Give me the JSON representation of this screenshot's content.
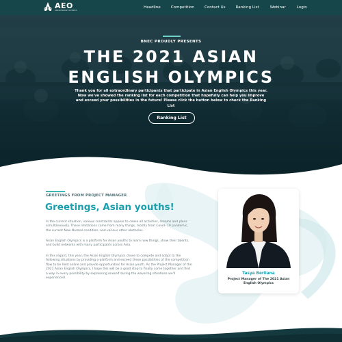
{
  "logo": {
    "text": "AEO",
    "subtitle": "ASIAN ENGLISH OLYMPICS"
  },
  "nav": {
    "items": [
      "Headline",
      "Competition",
      "Contact Us",
      "Ranking List",
      "Webinar",
      "Login"
    ]
  },
  "hero": {
    "presents": "BNEC PROUDLY PRESENTS",
    "title_line1": "The 2021 Asian",
    "title_line2": "English Olympics",
    "description": "Thank you for all extraordinary participants that participate in Asian English Olympics this year. Now we've showed the ranking list for each competition that hopefully can help you improve and exceed your possibilities in the future! Please click the button below to check the Ranking List",
    "button_label": "Ranking List"
  },
  "greeting": {
    "label": "GREETINGS FROM PROJECT MANAGER",
    "title": "Greetings, Asian youths!",
    "paragraphs": [
      "In the current situation, various constraints appear to cease all activities, dreams and plans simultaneously. These limitations come from many things, mostly from Covid- 19 pandemic, the current New Normal condition, and various other obstacles.",
      "Asian English Olympics is a platform for Asian youths to learn new things, show their talents, and build networks with many participants across Asia.",
      "In this regard, this year, the Asian English Olympics chose to compete and adapt to the following situations by providing a platform and exceed these possibilities of the competition flow to be held online and provide opportunities for Asian youth. As the Project Manager of the 2021 Asian English Olympics, I hope this will be a good step to finally come together and find a way in every possibility by expressing oneself during the wavering situations we'll experienced."
    ]
  },
  "profile": {
    "name": "Tasya Berliana",
    "role": "Project Manager of The 2021 Asian English Olympics"
  },
  "colors": {
    "accent": "#1a9fae",
    "nav_bg": "#16464a",
    "hero_dark": "#0e2930"
  }
}
